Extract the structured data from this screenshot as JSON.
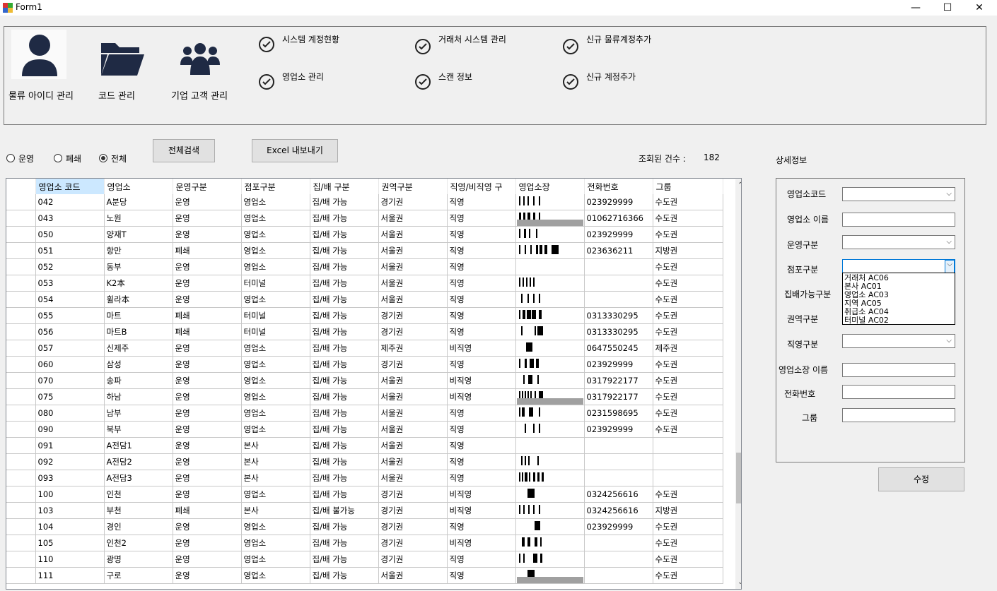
{
  "window": {
    "title": "Form1",
    "minimize": "—",
    "maximize": "☐",
    "close": "✕"
  },
  "top_menu": {
    "big": [
      {
        "label": "물류 아이디 관리",
        "icon": "user-icon"
      },
      {
        "label": "코드 관리",
        "icon": "folder-icon"
      },
      {
        "label": "기업 고객 관리",
        "icon": "group-icon"
      }
    ],
    "items": [
      "시스템 계정현황",
      "거래처 시스템 관리",
      "신규 물류계정추가",
      "영업소 관리",
      "스캔 정보",
      "신규 계정추가"
    ]
  },
  "filter": {
    "radio_labels": [
      "운영",
      "폐쇄",
      "전체"
    ],
    "selected": "전체",
    "search_button": "전체검색",
    "excel_button": "Excel 내보내기",
    "count_label": "조회된 건수 :",
    "count_value": "182"
  },
  "grid": {
    "columns": [
      "영업소 코드",
      "영업소",
      "운영구분",
      "점포구분",
      "집/배 구분",
      "권역구분",
      "직영/비직영 구",
      "영업소장",
      "전화번호",
      "그룹"
    ],
    "rows": [
      [
        "042",
        "A분당",
        "운영",
        "영업소",
        "집/배 가능",
        "경기권",
        "직영",
        "",
        "023929999",
        "수도권"
      ],
      [
        "043",
        "노원",
        "운영",
        "영업소",
        "집/배 가능",
        "서울권",
        "직영",
        "",
        "01062716366",
        "수도권"
      ],
      [
        "050",
        "양재T",
        "운영",
        "영업소",
        "집/배 가능",
        "서울권",
        "직영",
        "",
        "023929999",
        "수도권"
      ],
      [
        "051",
        "항만",
        "폐쇄",
        "영업소",
        "집/배 가능",
        "서울권",
        "직영",
        "",
        "023636211",
        "지방권"
      ],
      [
        "052",
        "동부",
        "운영",
        "영업소",
        "집/배 가능",
        "서울권",
        "직영",
        "",
        "",
        "수도권"
      ],
      [
        "053",
        "K2本",
        "운영",
        "터미널",
        "집/배 가능",
        "서울권",
        "직영",
        "",
        "",
        "수도권"
      ],
      [
        "054",
        "휠라本",
        "운영",
        "영업소",
        "집/배 가능",
        "서울권",
        "직영",
        "",
        "",
        "수도권"
      ],
      [
        "055",
        "마트",
        "폐쇄",
        "터미널",
        "집/배 가능",
        "경기권",
        "직영",
        "",
        "0313330295",
        "수도권"
      ],
      [
        "056",
        "마트B",
        "폐쇄",
        "터미널",
        "집/배 가능",
        "경기권",
        "직영",
        "",
        "0313330295",
        "수도권"
      ],
      [
        "057",
        "신제주",
        "운영",
        "영업소",
        "집/배 가능",
        "제주권",
        "비직영",
        "",
        "0647550245",
        "제주권"
      ],
      [
        "060",
        "삼성",
        "운영",
        "영업소",
        "집/배 가능",
        "경기권",
        "직영",
        "",
        "023929999",
        "수도권"
      ],
      [
        "070",
        "송파",
        "운영",
        "영업소",
        "집/배 가능",
        "서울권",
        "비직영",
        "",
        "0317922177",
        "수도권"
      ],
      [
        "075",
        "하남",
        "운영",
        "영업소",
        "집/배 가능",
        "서울권",
        "비직영",
        "",
        "0317922177",
        "수도권"
      ],
      [
        "080",
        "남부",
        "운영",
        "영업소",
        "집/배 가능",
        "서울권",
        "직영",
        "",
        "0231598695",
        "수도권"
      ],
      [
        "090",
        "북부",
        "운영",
        "영업소",
        "집/배 가능",
        "서울권",
        "직영",
        "",
        "023929999",
        "수도권"
      ],
      [
        "091",
        "A전담1",
        "운영",
        "본사",
        "집/배 가능",
        "서울권",
        "직영",
        "",
        "",
        ""
      ],
      [
        "092",
        "A전담2",
        "운영",
        "본사",
        "집/배 가능",
        "서울권",
        "직영",
        "",
        "",
        ""
      ],
      [
        "093",
        "A전담3",
        "운영",
        "본사",
        "집/배 가능",
        "서울권",
        "직영",
        "",
        "",
        ""
      ],
      [
        "100",
        "인천",
        "운영",
        "영업소",
        "집/배 가능",
        "경기권",
        "비직영",
        "",
        "0324256616",
        "수도권"
      ],
      [
        "103",
        "부천",
        "폐쇄",
        "본사",
        "집/배 불가능",
        "경기권",
        "비직영",
        "",
        "0324256616",
        "지방권"
      ],
      [
        "104",
        "경인",
        "운영",
        "영업소",
        "집/배 가능",
        "경기권",
        "직영",
        "",
        "023929999",
        "수도권"
      ],
      [
        "105",
        "인천2",
        "운영",
        "영업소",
        "집/배 가능",
        "경기권",
        "비직영",
        "",
        "",
        "수도권"
      ],
      [
        "110",
        "광명",
        "운영",
        "영업소",
        "집/배 가능",
        "경기권",
        "직영",
        "",
        "",
        "수도권"
      ],
      [
        "111",
        "구로",
        "운영",
        "영업소",
        "집/배 가능",
        "서울권",
        "직영",
        "",
        "",
        "수도권"
      ]
    ]
  },
  "detail": {
    "title": "상세정보",
    "labels": [
      "영업소코드",
      "영업소 이름",
      "운영구분",
      "점포구분",
      "집배가능구분",
      "권역구분",
      "직영구분",
      "영업소장 이름",
      "전화번호",
      "그룹"
    ],
    "dropdown_options": [
      "거래처 AC06",
      "본사 AC01",
      "영업소 AC03",
      "지역 AC05",
      "취급소 AC04",
      "터미널 AC02"
    ],
    "save_button": "수정"
  }
}
